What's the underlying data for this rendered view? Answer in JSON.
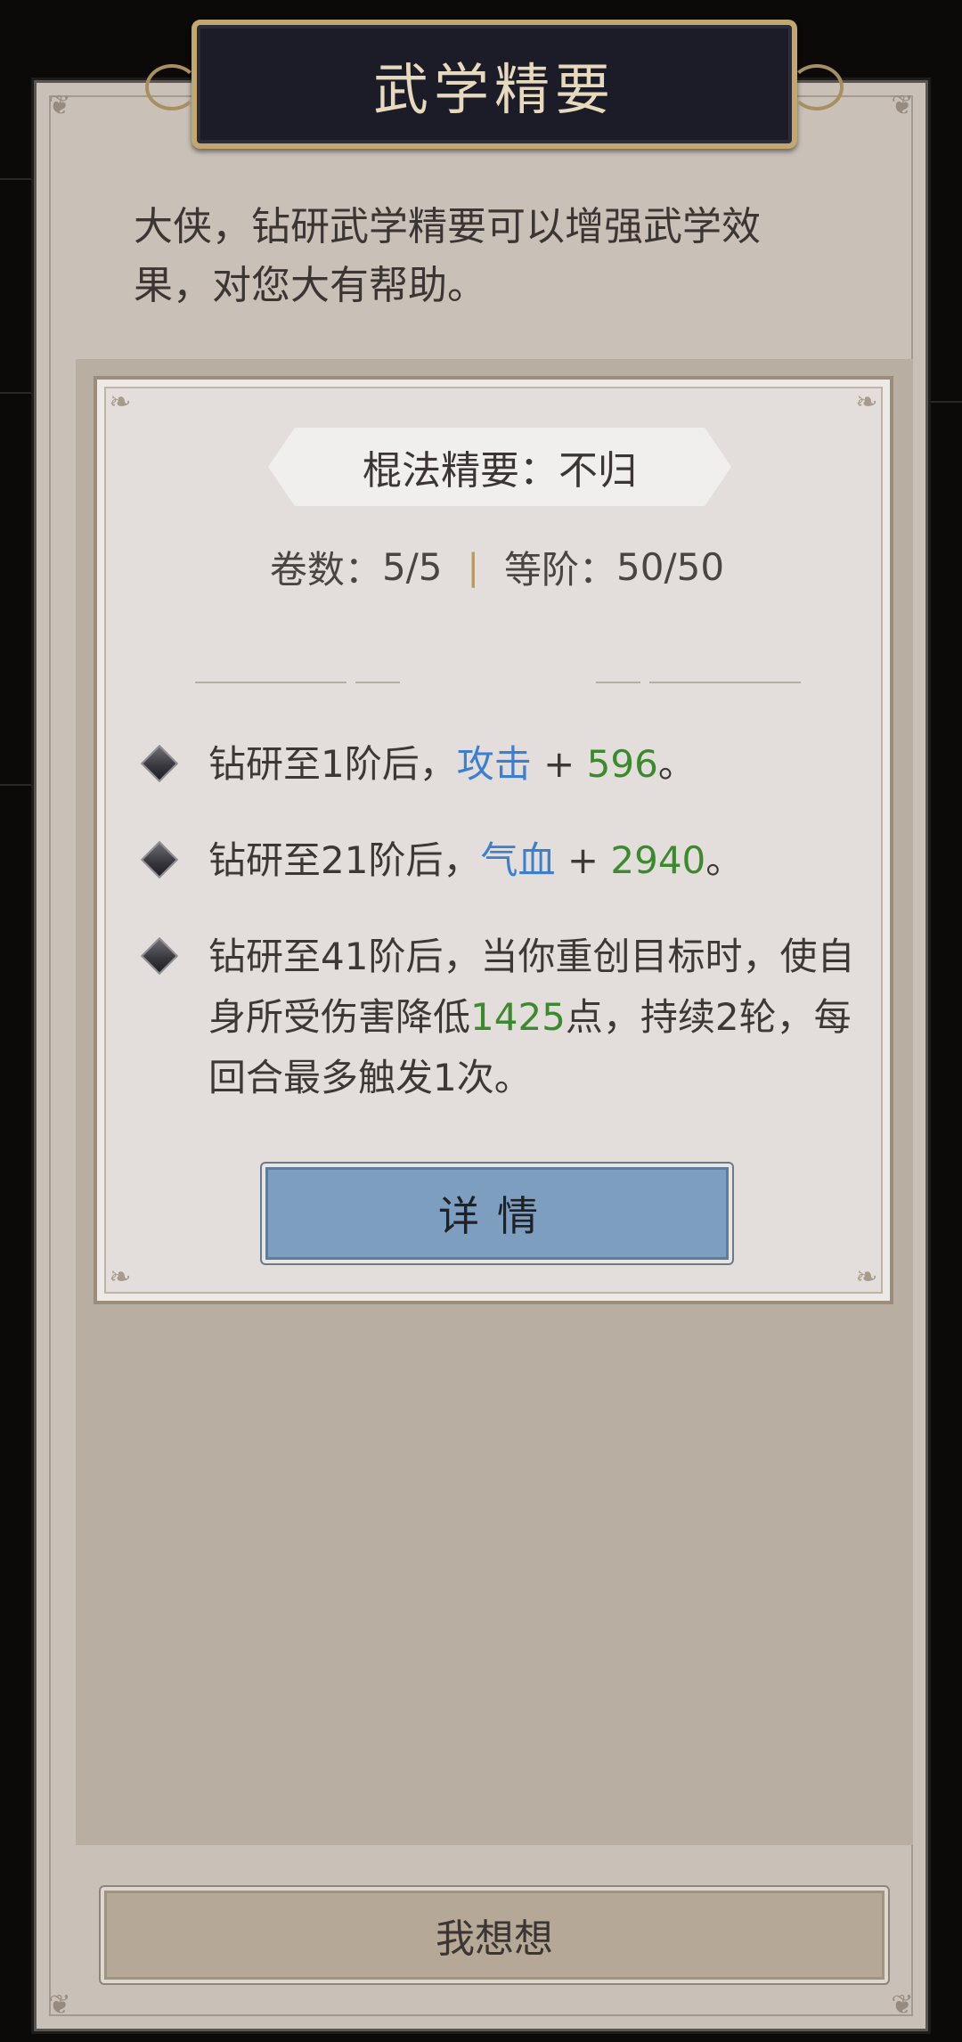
{
  "dialog": {
    "title": "武学精要",
    "intro": "大侠，钻研武学精要可以增强武学效果，对您大有帮助。"
  },
  "skill_card": {
    "name": "棍法精要：不归",
    "volumes_label": "卷数：",
    "volumes_value": "5/5",
    "separator": "|",
    "rank_label": "等阶：",
    "rank_value": "50/50",
    "effects": [
      {
        "prefix": "钻研至1阶后，",
        "attr": "攻击",
        "mid": " + ",
        "value": "596",
        "suffix": "。"
      },
      {
        "prefix": "钻研至21阶后，",
        "attr": "气血",
        "mid": " + ",
        "value": "2940",
        "suffix": "。"
      },
      {
        "prefix": "钻研至41阶后，当你重创目标时，使自身所受伤害降低",
        "value": "1425",
        "suffix": "点，持续2轮，每回合最多触发1次。"
      }
    ],
    "detail_button": "详情"
  },
  "footer": {
    "think_button": "我想想"
  },
  "colors": {
    "attribute": "#3a7fd0",
    "value": "#3b8a2e",
    "title_border": "#c2a76f",
    "detail_button": "#7d9ebf"
  }
}
